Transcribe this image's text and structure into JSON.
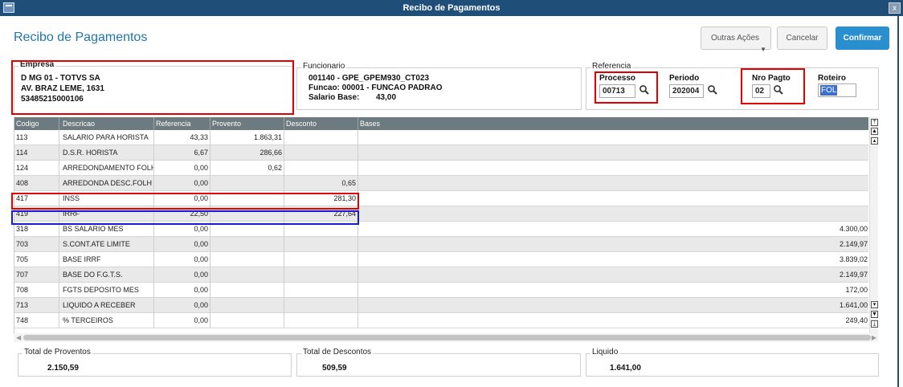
{
  "window": {
    "title": "Recibo de Pagamentos",
    "close_glyph": "x"
  },
  "header": {
    "title": "Recibo de Pagamentos",
    "outras_acoes_label": "Outras Ações",
    "cancelar_label": "Cancelar",
    "confirmar_label": "Confirmar",
    "accent_color": "#2a8fcf"
  },
  "empresa": {
    "caption": "Empresa",
    "lines": [
      "D MG 01  - TOTVS SA",
      "AV. BRAZ LEME, 1631",
      "53485215000106"
    ]
  },
  "funcionario": {
    "caption": "Funcionario",
    "line1": "001140 - GPE_GPEM930_CT023",
    "line2": "Funcao: 00001  - FUNCAO PADRAO",
    "salario_label": "Salario Base:",
    "salario_value": "43,00"
  },
  "referencia": {
    "caption": "Referencia",
    "processo_label": "Processo",
    "processo_value": "00713",
    "periodo_label": "Periodo",
    "periodo_value": "202004",
    "nro_pagto_label": "Nro Pagto",
    "nro_pagto_value": "02",
    "roteiro_label": "Roteiro",
    "roteiro_value": "FOL"
  },
  "grid": {
    "columns": [
      "Codigo",
      "Descricao",
      "Referencia",
      "Provento",
      "Desconto",
      "Bases"
    ],
    "rows": [
      [
        "113",
        "SALARIO PARA HORISTA",
        "43,33",
        "1.863,31",
        "",
        ""
      ],
      [
        "114",
        "D.S.R. HORISTA",
        "6,67",
        "286,66",
        "",
        ""
      ],
      [
        "124",
        "ARREDONDAMENTO FOLHA",
        "0,00",
        "0,62",
        "",
        ""
      ],
      [
        "408",
        "ARREDONDA DESC.FOLH",
        "0,00",
        "",
        "0,65",
        ""
      ],
      [
        "417",
        "INSS",
        "0,00",
        "",
        "281,30",
        ""
      ],
      [
        "419",
        "IRRF",
        "22,50",
        "",
        "227,64",
        ""
      ],
      [
        "318",
        "BS SALARIO MES",
        "0,00",
        "",
        "",
        "4.300,00"
      ],
      [
        "703",
        "S.CONT.ATE LIMITE",
        "0,00",
        "",
        "",
        "2.149,97"
      ],
      [
        "705",
        "BASE IRRF",
        "0,00",
        "",
        "",
        "3.839,02"
      ],
      [
        "707",
        "BASE DO F.G.T.S.",
        "0,00",
        "",
        "",
        "2.149,97"
      ],
      [
        "708",
        "FGTS DEPOSITO MES",
        "0,00",
        "",
        "",
        "172,00"
      ],
      [
        "713",
        "LIQUIDO A RECEBER",
        "0,00",
        "",
        "",
        "1.641,00"
      ],
      [
        "748",
        "% TERCEIROS",
        "0,00",
        "",
        "",
        "249,40"
      ]
    ]
  },
  "totals": {
    "proventos_label": "Total de Proventos",
    "proventos_value": "2.150,59",
    "descontos_label": "Total de Descontos",
    "descontos_value": "509,59",
    "liquido_label": "Liquido",
    "liquido_value": "1.641,00"
  },
  "highlight_colors": {
    "red": "#e00000",
    "blue": "#1a1ad6"
  }
}
